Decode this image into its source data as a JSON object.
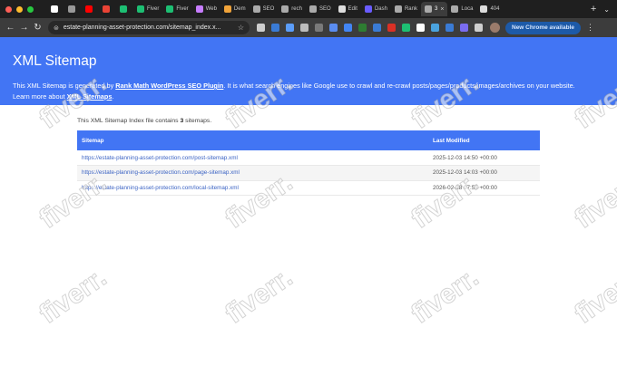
{
  "tabstrip": {
    "traffic_colors": [
      "#ff5f57",
      "#febc2e",
      "#28c840"
    ],
    "tabs": [
      {
        "label": "",
        "icon": "github-icon",
        "color": "#ffffff"
      },
      {
        "label": "",
        "icon": "circle-icon",
        "color": "#999999"
      },
      {
        "label": "",
        "icon": "youtube-icon",
        "color": "#ff0000"
      },
      {
        "label": "",
        "icon": "gmail-icon",
        "color": "#ea4335"
      },
      {
        "label": "",
        "icon": "fiverr-icon",
        "color": "#1dbf73"
      },
      {
        "label": "Fiver",
        "icon": "fiverr-icon",
        "color": "#1dbf73"
      },
      {
        "label": "Fiver",
        "icon": "fiverr-icon",
        "color": "#1dbf73"
      },
      {
        "label": "Web",
        "icon": "heart-icon",
        "color": "#c77dff"
      },
      {
        "label": "Dem",
        "icon": "doc-icon",
        "color": "#f0a33a"
      },
      {
        "label": "SEO",
        "icon": "globe-icon",
        "color": "#aaaaaa"
      },
      {
        "label": "rech",
        "icon": "globe-icon",
        "color": "#aaaaaa"
      },
      {
        "label": "SEO",
        "icon": "globe-icon",
        "color": "#aaaaaa"
      },
      {
        "label": "Edit",
        "icon": "edit-icon",
        "color": "#dddddd"
      },
      {
        "label": "Dash",
        "icon": "dash-icon",
        "color": "#6a5cff"
      },
      {
        "label": "Rank",
        "icon": "globe-icon",
        "color": "#aaaaaa"
      },
      {
        "label": "3",
        "icon": "globe-icon",
        "color": "#aaaaaa",
        "active": true
      },
      {
        "label": "Loca",
        "icon": "globe-icon",
        "color": "#aaaaaa"
      },
      {
        "label": "404",
        "icon": "globe-icon",
        "color": "#dddddd"
      }
    ],
    "new_tab": "+",
    "tab_search": "⌄"
  },
  "toolbar": {
    "back": "←",
    "forward": "→",
    "reload": "↻",
    "url": "estate-planning-asset-protection.com/sitemap_index.x...",
    "bookmark_star": "☆",
    "extension_colors": [
      "#cfcfcf",
      "#3a7bd5",
      "#5b9dfa",
      "#bcbcbc",
      "#7a7a7a",
      "#5a8cf0",
      "#4285f4",
      "#2e7d32",
      "#3a7bd5",
      "#d93025",
      "#1dbf73",
      "#ffffff",
      "#4aa3df",
      "#3a7bd5",
      "#7a6cf0",
      "#cfcfcf"
    ],
    "new_chrome_label": "New Chrome available",
    "menu": "⋮"
  },
  "banner": {
    "title": "XML Sitemap",
    "line1_prefix": "This XML Sitemap is generated by ",
    "line1_link": "Rank Math WordPress SEO Plugin",
    "line1_suffix": ". It is what search engines like Google use to crawl and re-crawl posts/pages/products/images/archives on your website.",
    "line2_prefix": "Learn more about ",
    "line2_link": "XML Sitemaps",
    "line2_suffix": ".",
    "color": "#4275f4"
  },
  "content": {
    "intro_prefix": "This XML Sitemap Index file contains ",
    "intro_count": "3",
    "intro_suffix": " sitemaps.",
    "headers": {
      "sitemap": "Sitemap",
      "last_modified": "Last Modified"
    },
    "rows": [
      {
        "url": "https://estate-planning-asset-protection.com/post-sitemap.xml",
        "modified": "2025-12-03 14:50 +00:00"
      },
      {
        "url": "https://estate-planning-asset-protection.com/page-sitemap.xml",
        "modified": "2025-12-03 14:03 +00:00"
      },
      {
        "url": "https://estate-planning-asset-protection.com/local-sitemap.xml",
        "modified": "2026-02-28 07:55 +00:00"
      }
    ]
  },
  "watermark": "fiverr."
}
